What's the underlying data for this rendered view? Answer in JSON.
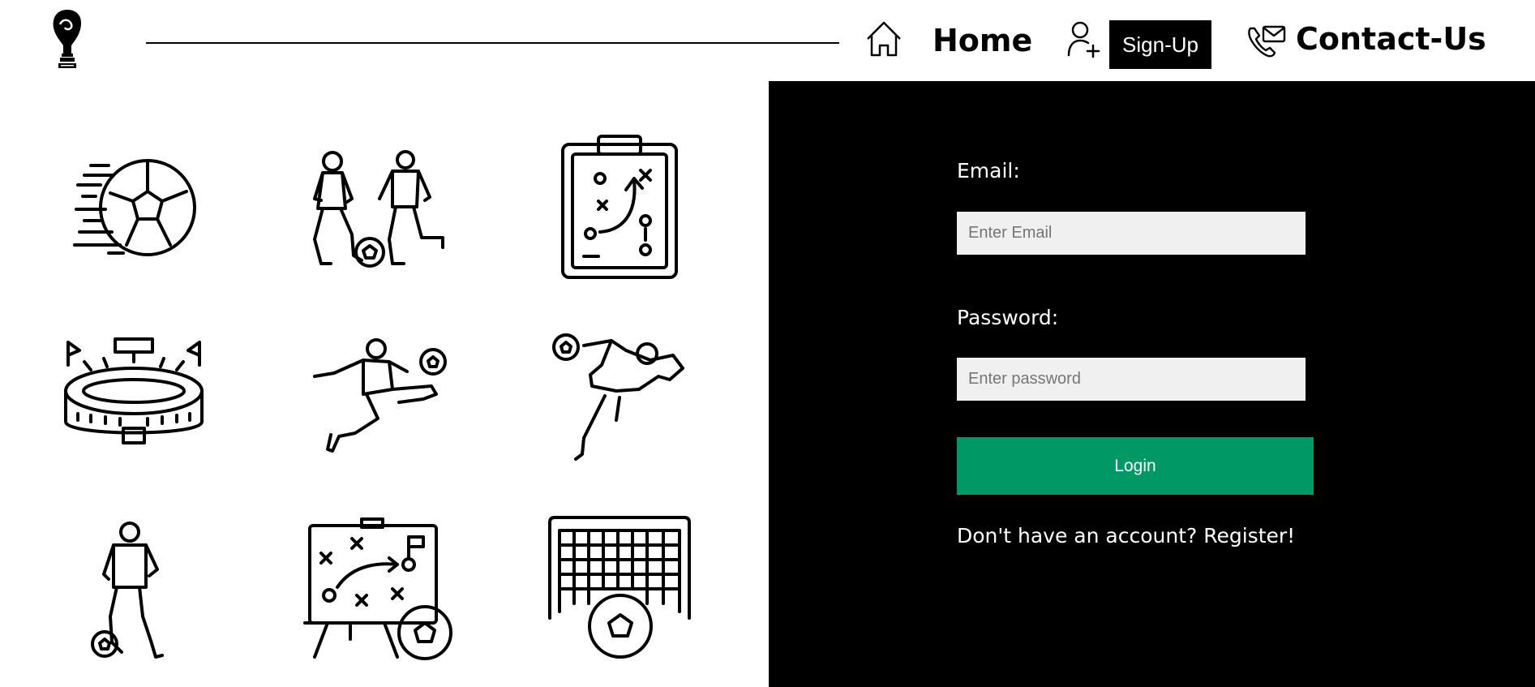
{
  "header": {
    "logo": "trophy-logo-icon",
    "nav": {
      "home_label": "Home",
      "signup_label": "Sign-Up",
      "contact_label": "Contact-Us"
    }
  },
  "icons": [
    "speeding-ball-icon",
    "two-players-icon",
    "tactics-clipboard-icon",
    "stadium-icon",
    "kicking-player-icon",
    "goalkeeper-dive-icon",
    "dribbling-player-icon",
    "tactics-board-icon",
    "goal-net-icon"
  ],
  "login": {
    "email_label": "Email:",
    "email_placeholder": "Enter Email",
    "password_label": "Password:",
    "password_placeholder": "Enter password",
    "button_label": "Login",
    "register_prompt": "Don't have an account? ",
    "register_link": "Register!"
  },
  "colors": {
    "panel_bg": "#000000",
    "login_button": "#009966",
    "input_bg": "#f0f0f0"
  }
}
